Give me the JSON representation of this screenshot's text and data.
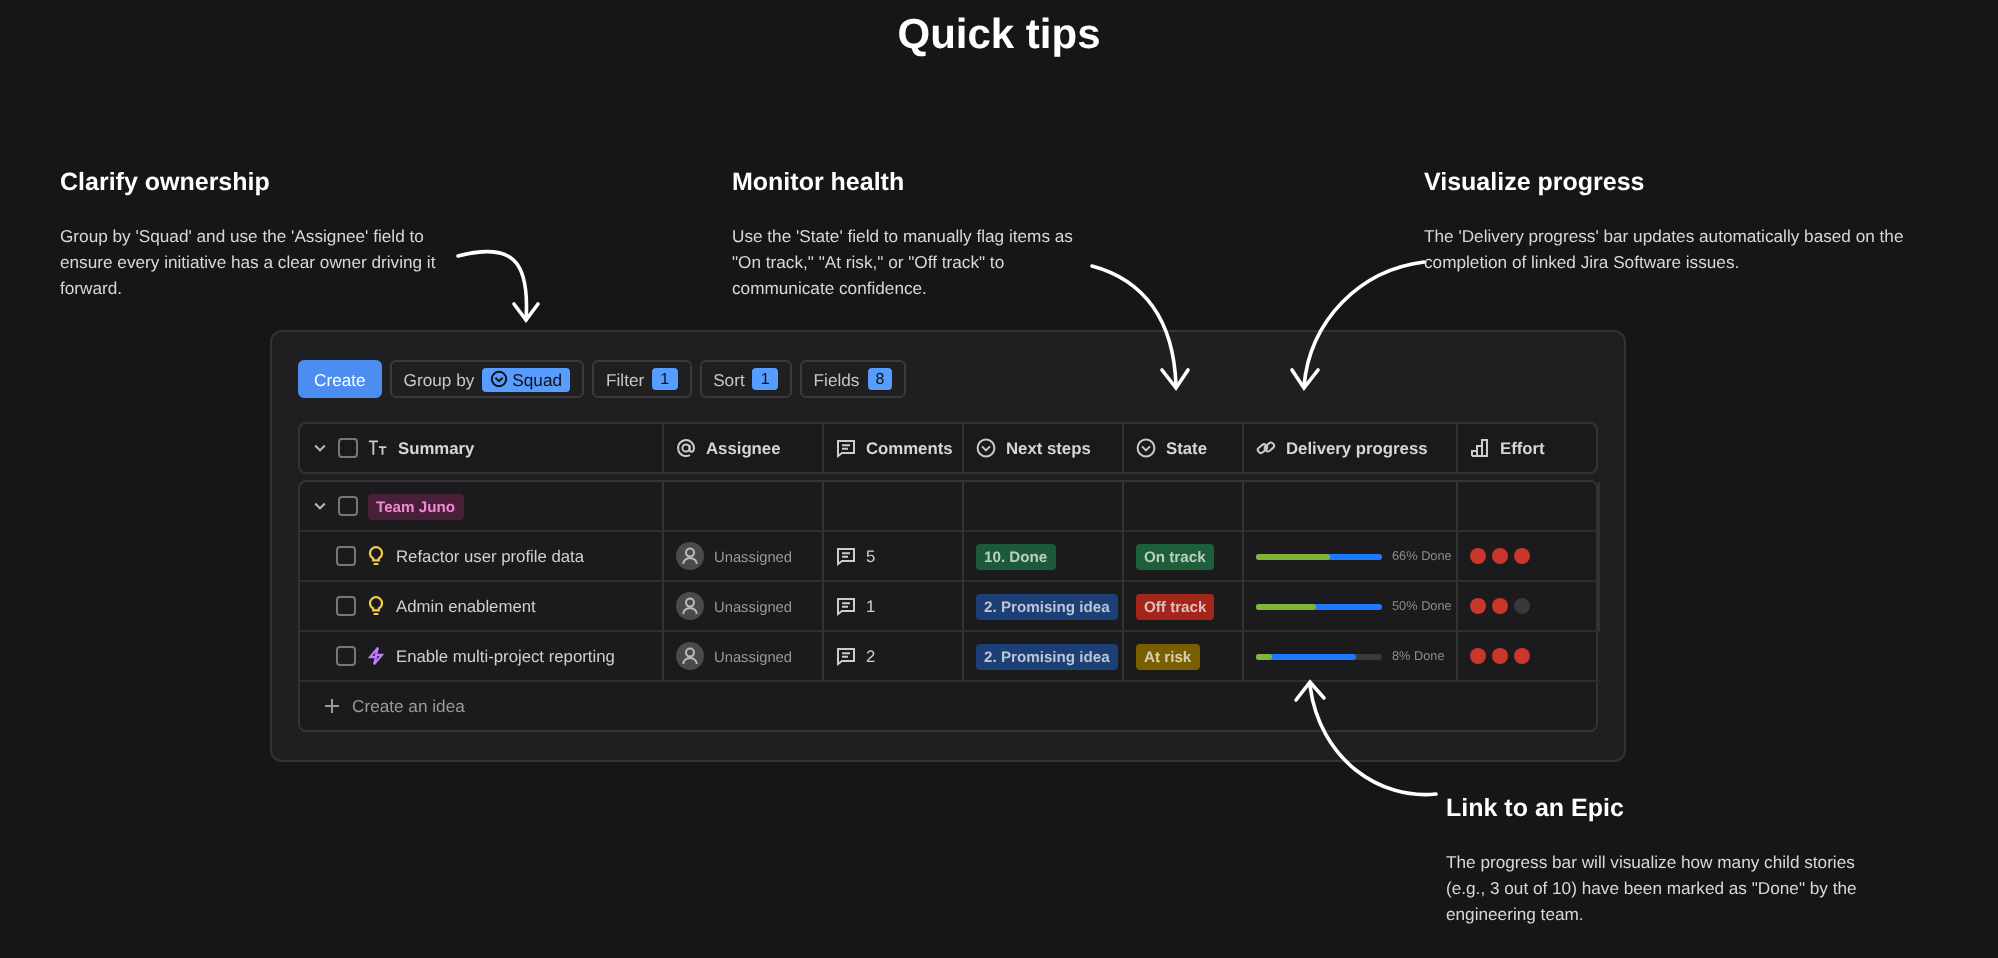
{
  "title": "Quick tips",
  "tips": [
    {
      "heading": "Clarify ownership",
      "body": "Group by 'Squad' and use the 'Assignee' field to ensure every initiative has a clear owner driving it forward."
    },
    {
      "heading": "Monitor health",
      "body": "Use the 'State' field to manually flag items as \"On track,\" \"At risk,\" or \"Off track\" to communicate confidence."
    },
    {
      "heading": "Visualize progress",
      "body": "The 'Delivery progress' bar updates automatically based on the completion of linked Jira Software issues."
    }
  ],
  "toolbar": {
    "create": "Create",
    "group_by": {
      "label": "Group by",
      "value": "Squad"
    },
    "filters": [
      {
        "label": "Filter",
        "count": "1"
      },
      {
        "label": "Sort",
        "count": "1"
      },
      {
        "label": "Fields",
        "count": "8"
      }
    ]
  },
  "table": {
    "columns": [
      "Summary",
      "Assignee",
      "Comments",
      "Next steps",
      "State",
      "Delivery progress",
      "Effort"
    ],
    "header_checked": false,
    "groups": [
      {
        "name": "Team Juno",
        "color": "#4a1f3a",
        "expanded": true,
        "checked": false,
        "rows": [
          {
            "kind": "idea",
            "checked": false,
            "summary": "Refactor user profile data",
            "assignee": "Unassigned",
            "comments": "5",
            "next_step": {
              "label": "10. Done",
              "color": "#1c5a3a"
            },
            "state": {
              "label": "On track",
              "color": "#1d5e3b"
            },
            "progress": {
              "done": {
                "level": 0.58
              },
              "started": {
                "level": 1
              },
              "label": "66% Done"
            },
            "stars": 3
          },
          {
            "kind": "idea",
            "checked": false,
            "summary": "Admin enablement",
            "assignee": "Unassigned",
            "comments": "1",
            "next_step": {
              "label": "2. Promising idea",
              "color": "#1c3f75"
            },
            "state": {
              "label": "Off track",
              "color": "#a3261c"
            },
            "progress": {
              "done": {
                "level": 0.48
              },
              "started": {
                "level": 1
              },
              "label": "50% Done"
            },
            "stars": 2
          },
          {
            "kind": "feature",
            "checked": false,
            "summary": "Enable multi-project reporting",
            "assignee": "Unassigned",
            "comments": "2",
            "next_step": {
              "label": "2. Promising idea",
              "color": "#1c3f75"
            },
            "state": {
              "label": "At risk",
              "color": "#7a5f00"
            },
            "progress": {
              "done": {
                "level": 0.13
              },
              "started": {
                "level": 0.8
              },
              "label": "8% Done"
            },
            "stars": 3
          }
        ]
      }
    ],
    "create_label": "Create an idea"
  },
  "bottom_tip": {
    "heading": "Link to an Epic",
    "body": "The progress bar will visualize how many child stories (e.g., 3 out of 10) have been marked as \"Done\" by the engineering team."
  }
}
